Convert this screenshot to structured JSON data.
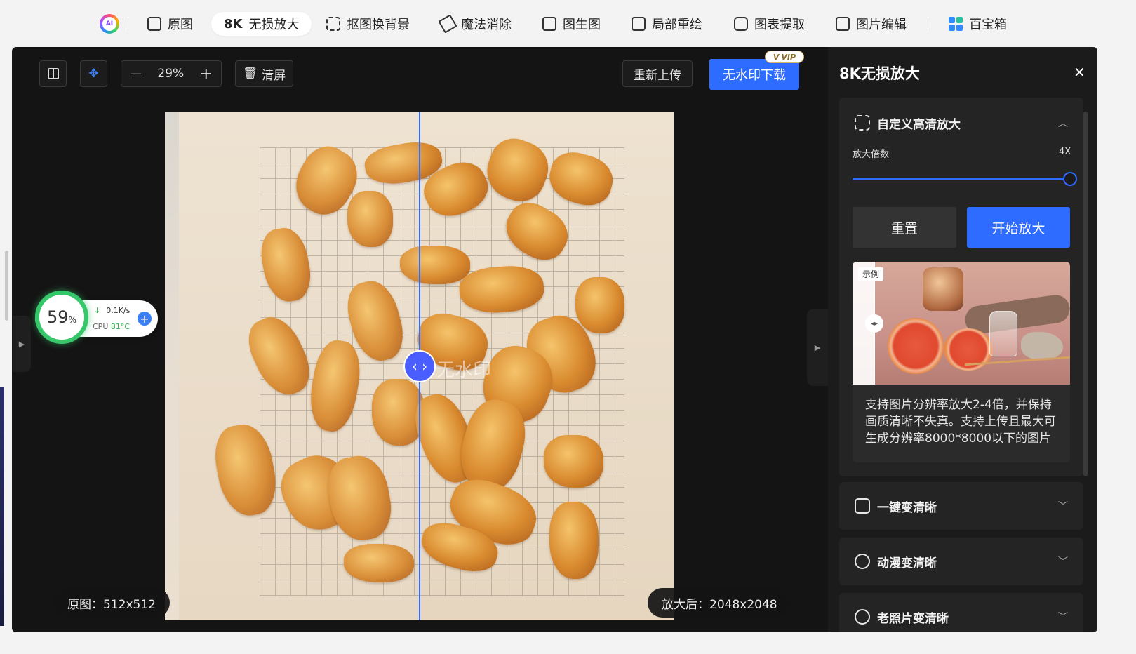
{
  "nav": {
    "items": [
      {
        "label": "原图",
        "icon": "image-icon"
      },
      {
        "label": "无损放大",
        "prefix": "8K",
        "icon": "8k-icon",
        "active": true
      },
      {
        "label": "抠图换背景",
        "icon": "cutout-icon"
      },
      {
        "label": "魔法消除",
        "icon": "eraser-icon"
      },
      {
        "label": "图生图",
        "icon": "image-to-image-icon"
      },
      {
        "label": "局部重绘",
        "icon": "repaint-icon"
      },
      {
        "label": "图表提取",
        "icon": "chart-extract-icon"
      },
      {
        "label": "图片编辑",
        "icon": "image-edit-icon"
      },
      {
        "label": "百宝箱",
        "icon": "toolbox-icon"
      }
    ],
    "logo_text": "AI"
  },
  "toolbar": {
    "zoom": "29%",
    "clear_label": "清屏",
    "reupload_label": "重新上传",
    "download_label": "无水印下载",
    "vip_badge": "VIP"
  },
  "canvas": {
    "original_label": "原图：512x512",
    "result_label": "放大后：2048x2048",
    "watermark": "无水印"
  },
  "perf": {
    "percent": "59",
    "percent_unit": "%",
    "net": "0.1K/s",
    "cpu_label": "CPU",
    "cpu_temp": "81°C"
  },
  "panel": {
    "title": "8K无损放大",
    "custom": {
      "title": "自定义高清放大",
      "scale_label": "放大倍数",
      "scale_value": "4X",
      "scale_fraction": 1.0,
      "reset_label": "重置",
      "start_label": "开始放大",
      "example_tag": "示例",
      "description": "支持图片分辨率放大2-4倍，并保持画质清晰不失真。支持上传且最大可生成分辨率8000*8000以下的图片"
    },
    "sections": [
      {
        "title": "一键变清晰",
        "icon": "sparkle-image-icon"
      },
      {
        "title": "动漫变清晰",
        "icon": "anime-icon"
      },
      {
        "title": "老照片变清晰",
        "icon": "old-photo-icon"
      }
    ]
  },
  "colors": {
    "accent": "#2e6bff",
    "panel_bg": "#1b1b1b",
    "canvas_bg": "#141414"
  }
}
